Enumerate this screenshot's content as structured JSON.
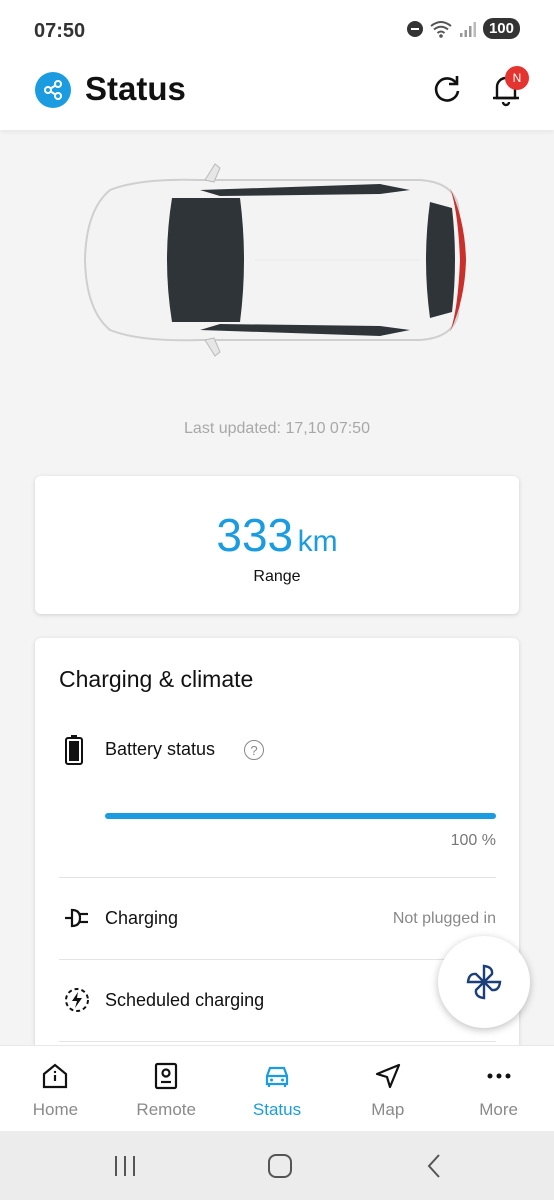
{
  "status_bar": {
    "time": "07:50",
    "battery": "100"
  },
  "app_bar": {
    "title": "Status",
    "notification_badge": "N"
  },
  "vehicle": {
    "last_updated": "Last updated: 17,10 07:50"
  },
  "range": {
    "value": "333",
    "unit": "km",
    "label": "Range"
  },
  "charging_climate": {
    "title": "Charging & climate",
    "battery_label": "Battery status",
    "battery_help": "?",
    "battery_level": 100,
    "battery_percent_text": "100 %",
    "charging_label": "Charging",
    "charging_value": "Not plugged in",
    "scheduled_label": "Scheduled charging"
  },
  "bottom_nav": [
    {
      "label": "Home",
      "icon": "home-icon"
    },
    {
      "label": "Remote",
      "icon": "remote-icon"
    },
    {
      "label": "Status",
      "icon": "car-icon",
      "active": true
    },
    {
      "label": "Map",
      "icon": "navigation-arrow-icon"
    },
    {
      "label": "More",
      "icon": "more-dots-icon"
    }
  ],
  "colors": {
    "accent": "#1b9ce0",
    "badge": "#e3342f",
    "fan": "#1c3f7a"
  }
}
